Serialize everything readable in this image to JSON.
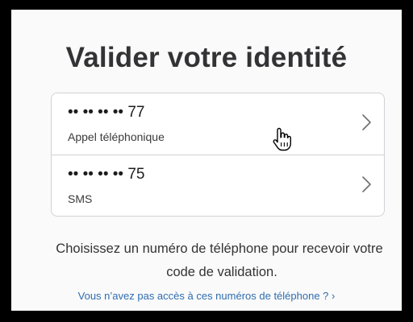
{
  "page": {
    "title": "Valider votre identité"
  },
  "options": [
    {
      "number": "•• •• •• •• 77",
      "method": "Appel téléphonique"
    },
    {
      "number": "•• •• •• •• 75",
      "method": "SMS"
    }
  ],
  "info": {
    "line1": "Choisissez un numéro de téléphone pour recevoir votre",
    "line2": "code de validation."
  },
  "link": {
    "label": "Vous n’avez pas accès à ces numéros de téléphone ? ›"
  },
  "colors": {
    "background": "#fafafa",
    "text": "#333336",
    "link": "#2f6db0",
    "border": "#d2d2d7"
  },
  "icons": {
    "chevron": "chevron-right-icon",
    "cursor": "hand-pointer-cursor-icon"
  }
}
